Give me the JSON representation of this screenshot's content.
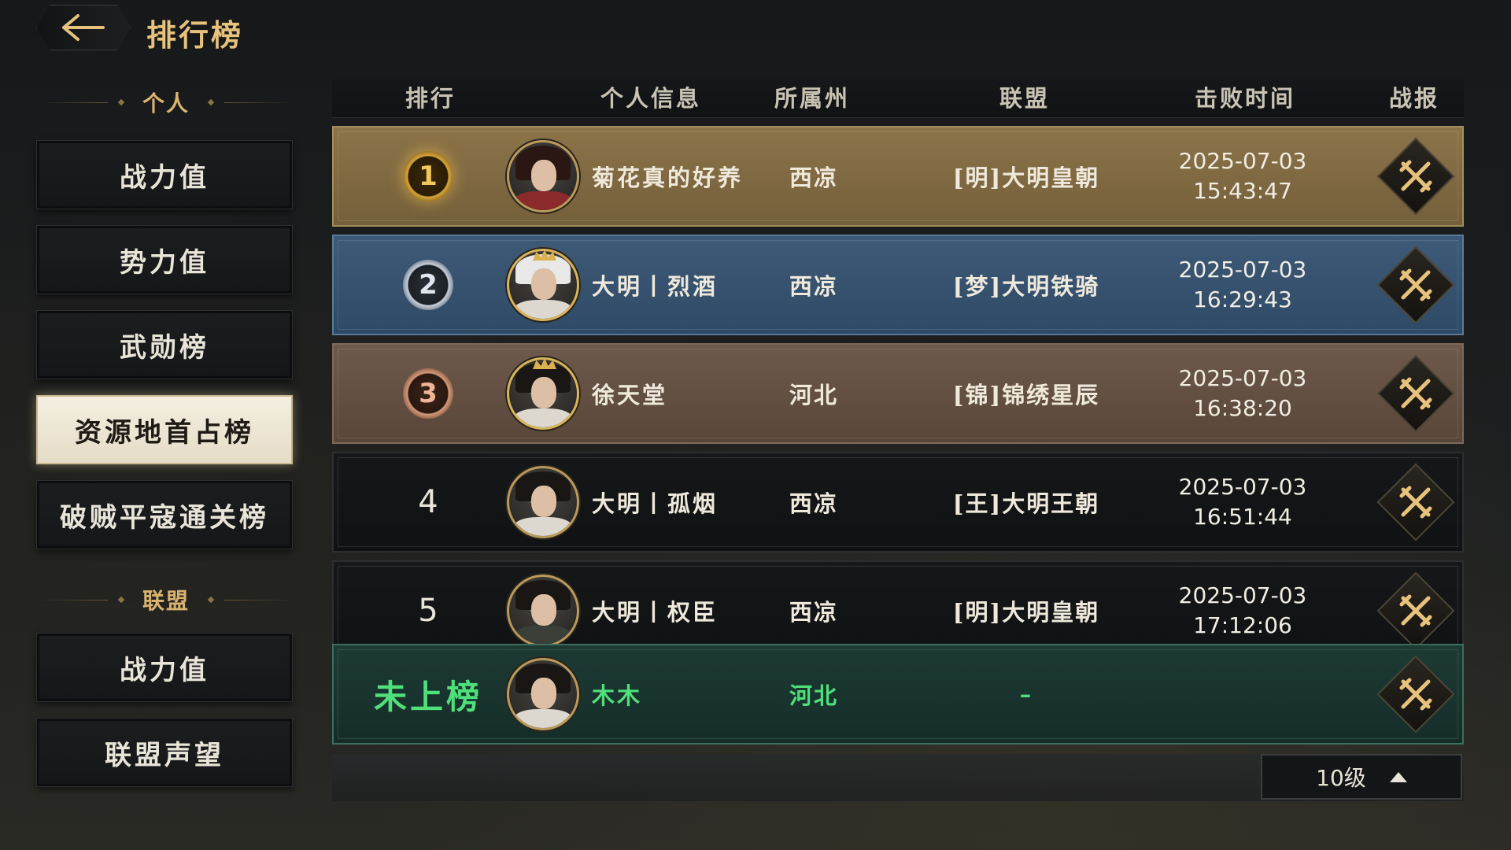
{
  "header": {
    "title": "排行榜"
  },
  "sidebar": {
    "personal_heading": "个人",
    "personal_items": [
      {
        "label": "战力值"
      },
      {
        "label": "势力值"
      },
      {
        "label": "武勋榜"
      },
      {
        "label": "资源地首占榜",
        "active": true
      },
      {
        "label": "破贼平寇通关榜"
      }
    ],
    "alliance_heading": "联盟",
    "alliance_items": [
      {
        "label": "战力值"
      },
      {
        "label": "联盟声望"
      }
    ]
  },
  "table": {
    "columns": [
      "排行",
      "个人信息",
      "所属州",
      "联盟",
      "击败时间",
      "战报"
    ],
    "rows": [
      {
        "rank": "1",
        "name": "菊花真的好养",
        "region": "西凉",
        "alliance": "[明]大明皇朝",
        "date": "2025-07-03",
        "time": "15:43:47"
      },
      {
        "rank": "2",
        "name": "大明丨烈酒",
        "region": "西凉",
        "alliance": "[梦]大明铁骑",
        "date": "2025-07-03",
        "time": "16:29:43"
      },
      {
        "rank": "3",
        "name": "徐天堂",
        "region": "河北",
        "alliance": "[锦]锦绣星辰",
        "date": "2025-07-03",
        "time": "16:38:20"
      },
      {
        "rank": "4",
        "name": "大明丨孤烟",
        "region": "西凉",
        "alliance": "[王]大明王朝",
        "date": "2025-07-03",
        "time": "16:51:44"
      },
      {
        "rank": "5",
        "name": "大明丨权臣",
        "region": "西凉",
        "alliance": "[明]大明皇朝",
        "date": "2025-07-03",
        "time": "17:12:06"
      }
    ],
    "mine": {
      "rank": "未上榜",
      "name": "木木",
      "region": "河北",
      "alliance": "–"
    }
  },
  "footer": {
    "level_label": "10级"
  },
  "colors": {
    "gold_accent": "#e6c27c",
    "mine_green": "#4fe07a"
  },
  "icons": {
    "back": "arrow-left-icon",
    "report": "crossed-swords-icon",
    "level": "caret-up-icon"
  }
}
